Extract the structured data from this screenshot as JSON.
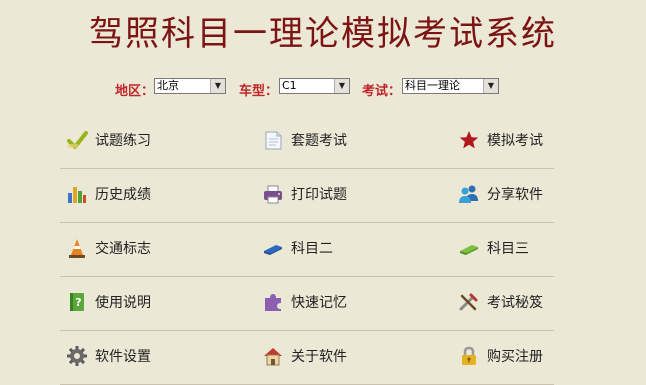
{
  "title": "驾照科目一理论模拟考试系统",
  "filters": {
    "region_label": "地区：",
    "region_value": "北京",
    "cartype_label": "车型：",
    "cartype_value": "C1",
    "exam_label": "考试：",
    "exam_value": "科目一理论"
  },
  "menu": [
    [
      "试题练习",
      "套题考试",
      "模拟考试"
    ],
    [
      "历史成绩",
      "打印试题",
      "分享软件"
    ],
    [
      "交通标志",
      "科目二",
      "科目三"
    ],
    [
      "使用说明",
      "快速记忆",
      "考试秘笈"
    ],
    [
      "软件设置",
      "关于软件",
      "购买注册"
    ]
  ],
  "icons": [
    [
      "checkmark-icon",
      "document-icon",
      "star-icon"
    ],
    [
      "bar-chart-icon",
      "printer-icon",
      "users-icon"
    ],
    [
      "traffic-cone-icon",
      "eraser-blue-icon",
      "eraser-green-icon"
    ],
    [
      "help-book-icon",
      "puzzle-icon",
      "tools-icon"
    ],
    [
      "gear-icon",
      "house-icon",
      "lock-icon"
    ]
  ],
  "colors": {
    "background": "#ece8d6",
    "title": "#7c1414",
    "filter_label": "#c0262a"
  }
}
